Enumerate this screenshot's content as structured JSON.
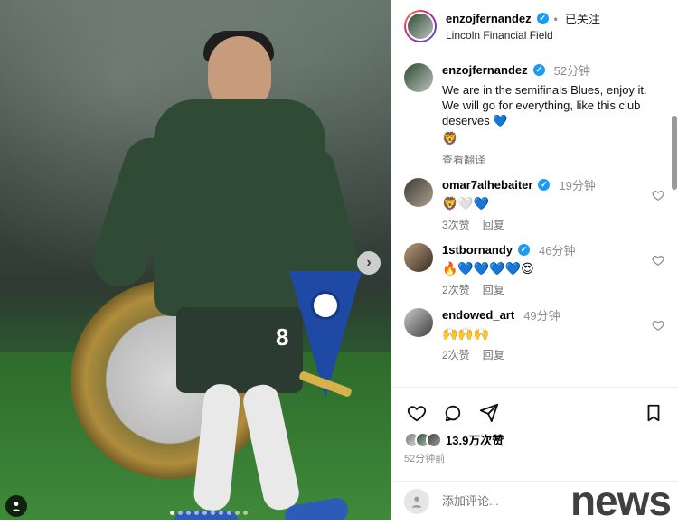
{
  "post": {
    "username": "enzojfernandez",
    "follow_status": "已关注",
    "location": "Lincoln Financial Field",
    "caption_time": "52分钟",
    "caption_text": "We are in the semifinals Blues, enjoy it. We will go for everything, like this club deserves 💙",
    "caption_extra_emoji": "🦁",
    "see_translation": "查看翻译",
    "likes_text": "13.9万次赞",
    "post_age": "52分钟前",
    "add_comment_placeholder": "添加评论..."
  },
  "comments": [
    {
      "username": "omar7alhebaiter",
      "time": "19分钟",
      "text": "🦁🤍💙",
      "likes": "3次赞",
      "reply": "回复"
    },
    {
      "username": "1stbornandy",
      "time": "46分钟",
      "text": "🔥💙💙💙💙😍",
      "likes": "2次赞",
      "reply": "回复"
    },
    {
      "username": "endowed_art",
      "time": "49分钟",
      "text": "🙌🙌🙌",
      "likes": "2次赞",
      "reply": "回复"
    }
  ],
  "photo": {
    "shorts_number": "8"
  },
  "overlay": {
    "watermark": "news"
  },
  "colors": {
    "verified": "#1d9bf0",
    "text_secondary": "#8e8e8e"
  },
  "icons": {
    "like": "heart-icon",
    "comment": "comment-icon",
    "share": "send-icon",
    "save": "bookmark-icon",
    "next": "chevron-right-icon",
    "user_tag": "user-tag-icon"
  }
}
